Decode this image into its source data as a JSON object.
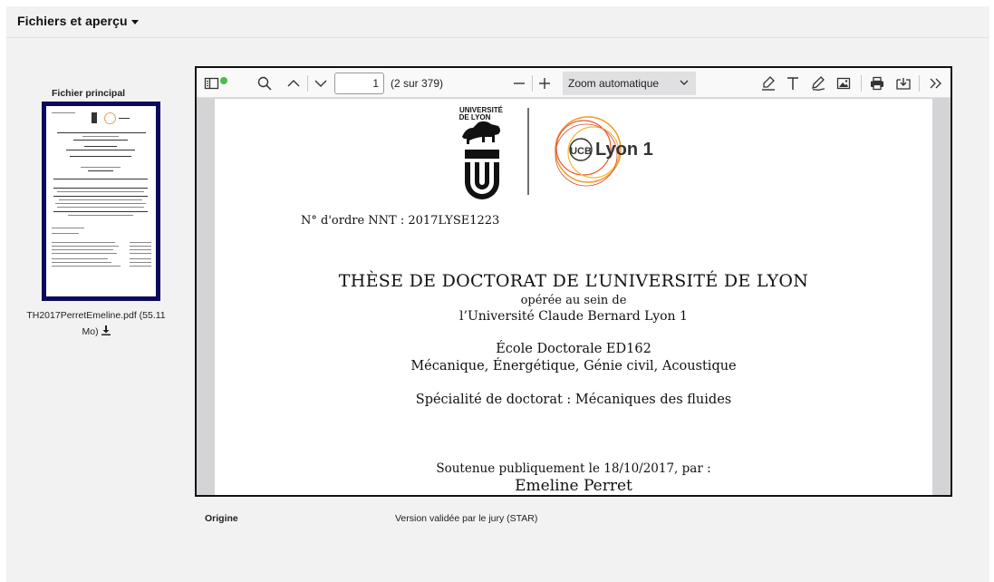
{
  "panel": {
    "title": "Fichiers et aperçu"
  },
  "sidebar": {
    "main_file_label": "Fichier principal",
    "file_name": "TH2017PerretEmeline.pdf (55.11 Mo)"
  },
  "toolbar": {
    "page_number": "1",
    "page_count": "(2 sur 379)",
    "zoom": "Zoom automatique",
    "icons": [
      "sidebar-toggle-icon",
      "search-icon",
      "chevron-up-icon",
      "chevron-down-icon",
      "minus-icon",
      "plus-icon",
      "highlight-icon",
      "text-icon",
      "draw-icon",
      "image-icon",
      "print-icon",
      "download-icon",
      "more-tools-icon"
    ]
  },
  "pdf": {
    "logo_university": "UNIVERSITÉ DE LYON",
    "logo_lyon1_mark": "UCB",
    "logo_lyon1": "Lyon 1",
    "nnt": "N° d'ordre NNT : 2017LYSE1223",
    "thesis_title": "THÈSE DE DOCTORAT DE L’UNIVERSITÉ DE LYON",
    "operee": "opérée au sein de",
    "university": "l’Université Claude Bernard Lyon 1",
    "ecole": "École Doctorale ED162",
    "mecanique": "Mécanique, Énergétique, Génie civil, Acoustique",
    "specialite": "Spécialité de doctorat : Mécaniques des fluides",
    "soutenue": "Soutenue publiquement le 18/10/2017, par :",
    "author": "Emeline Perret"
  },
  "metadata": {
    "origin_label": "Origine",
    "origin_value": "Version validée par le jury (STAR)"
  },
  "colors": {
    "thumb_border": "#0c0a5c",
    "panel_bg": "#f2f2f2",
    "status_dot": "#4cbb4c"
  }
}
